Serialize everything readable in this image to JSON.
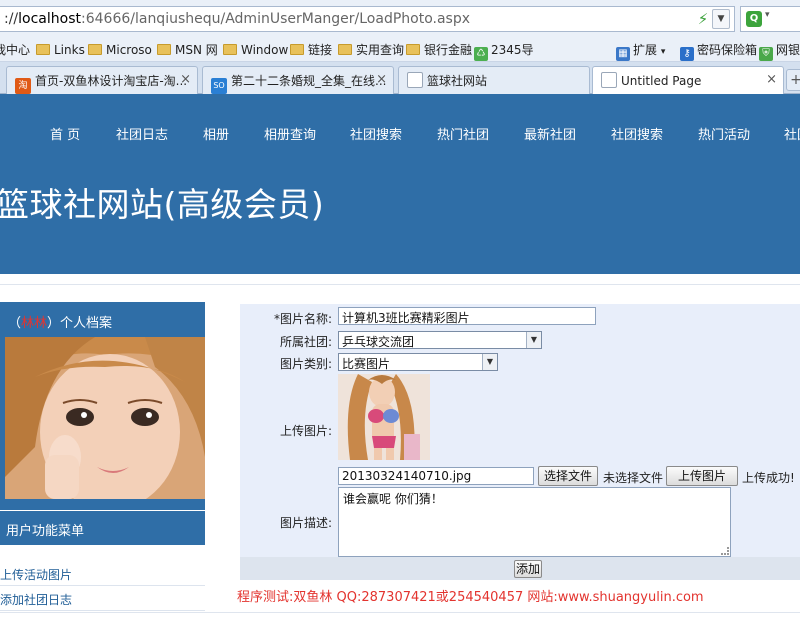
{
  "browser": {
    "address": {
      "scheme": "://",
      "host": "localhost",
      "path": ":64666/lanqiushequ/AdminUserManger/LoadPhoto.aspx"
    },
    "search_badge": "Q",
    "favorites": [
      "我中心",
      "Links",
      "Microso",
      "MSN 网",
      "Window",
      "链接",
      "实用查询",
      "银行金融",
      "2345导"
    ],
    "favorites_right": {
      "extend": "扩展",
      "password": "密码保险箱",
      "bank": "网银"
    },
    "tabs": [
      {
        "label": "首页-双鱼林设计淘宝店-淘...",
        "icon": "淘",
        "icon_color": "#e05a16"
      },
      {
        "label": "第二十二条婚规_全集_在线...",
        "icon": "SO",
        "icon_color": "#2a7fd4"
      },
      {
        "label": "篮球社网站",
        "icon": "page",
        "icon_color": "#ffffff"
      },
      {
        "label": "Untitled Page",
        "icon": "page",
        "icon_color": "#ffffff",
        "active": true
      }
    ],
    "tab_close": "×",
    "new_tab": "+"
  },
  "header": {
    "nav": [
      "首 页",
      "社团日志",
      "相册",
      "相册查询",
      "社团搜索",
      "热门社团",
      "最新社团",
      "社团搜索",
      "热门活动",
      "社团"
    ],
    "title": "篮球社网站(高级会员)"
  },
  "sidebar": {
    "profile_prefix": "（",
    "profile_user": "林林",
    "profile_suffix": "）个人档案",
    "menu_title": "用户功能菜单",
    "links": [
      "上传活动图片",
      "添加社团日志"
    ]
  },
  "form": {
    "name_label": "*图片名称:",
    "name_value": "计算机3班比赛精彩图片",
    "club_label": "所属社团:",
    "club_value": "乒乓球交流团",
    "type_label": "图片类别:",
    "type_value": "比赛图片",
    "upload_label": "上传图片:",
    "file_value": "20130324140710.jpg",
    "choose_file_button": "选择文件",
    "no_file_text": "未选择文件",
    "upload_button": "上传图片",
    "upload_status": "上传成功!",
    "desc_label": "图片描述:",
    "desc_value": "谁会赢呢  你们猜！",
    "submit_button": "添加"
  },
  "footer": {
    "credit": "程序测试:双鱼林 QQ:287307421或254540457 网站:www.shuangyulin.com"
  },
  "colors": {
    "header_blue": "#2f6ea7",
    "credit_red": "#e3342f",
    "form_bg": "#e8eefa"
  }
}
